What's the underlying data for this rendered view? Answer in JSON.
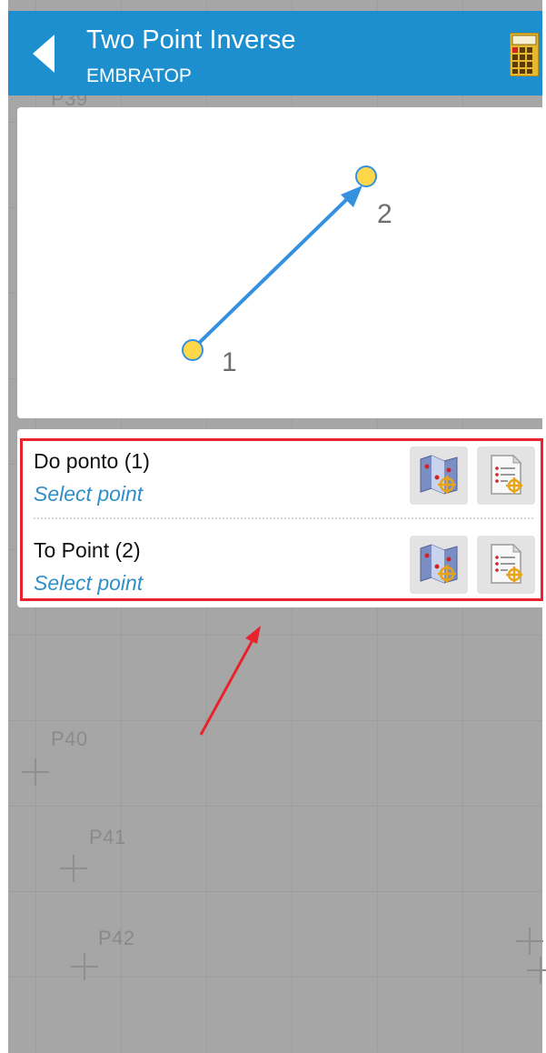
{
  "header": {
    "title": "Two Point Inverse",
    "subtitle": "EMBRATOP",
    "back_icon": "back-arrow-icon",
    "calculator_icon": "calculator-icon"
  },
  "diagram": {
    "point_1_label": "1",
    "point_2_label": "2",
    "line_color": "#3591e0",
    "point_color": "#ffd84a"
  },
  "points": [
    {
      "label": "Do ponto (1)",
      "value": "Select point",
      "map_icon": "map-select-icon",
      "list_icon": "list-select-icon"
    },
    {
      "label": "To Point (2)",
      "value": "Select point",
      "map_icon": "map-select-icon",
      "list_icon": "list-select-icon"
    }
  ],
  "map": {
    "labels": [
      "P39",
      "P40",
      "P41",
      "P42"
    ]
  },
  "colors": {
    "header_bg": "#1d8fcf",
    "highlight": "#e8232d",
    "link_text": "#2f8fc7"
  }
}
